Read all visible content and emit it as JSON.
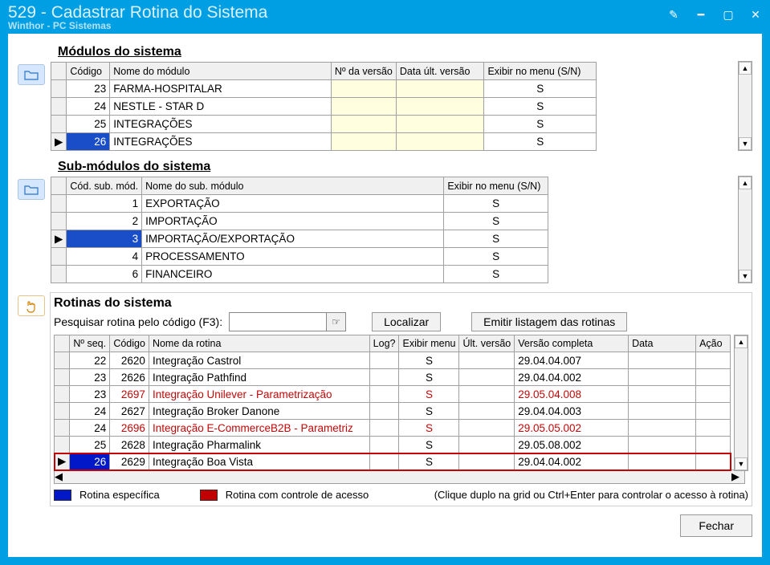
{
  "window": {
    "title": "529 - Cadastrar Rotina do Sistema",
    "subtitle": "Winthor - PC Sistemas"
  },
  "modules": {
    "title": "Módulos do sistema",
    "headers": {
      "code": "Código",
      "name": "Nome do módulo",
      "ver": "Nº da versão",
      "date": "Data últ. versão",
      "show": "Exibir no menu (S/N)"
    },
    "rows": [
      {
        "code": "23",
        "name": "FARMA-HOSPITALAR",
        "ver": "",
        "date": "",
        "show": "S",
        "selected": false
      },
      {
        "code": "24",
        "name": "NESTLE - STAR D",
        "ver": "",
        "date": "",
        "show": "S",
        "selected": false
      },
      {
        "code": "25",
        "name": "INTEGRAÇÕES",
        "ver": "",
        "date": "",
        "show": "S",
        "selected": false
      },
      {
        "code": "26",
        "name": "INTEGRAÇÕES",
        "ver": "",
        "date": "",
        "show": "S",
        "selected": true
      }
    ]
  },
  "submodules": {
    "title": "Sub-módulos do sistema",
    "headers": {
      "code": "Cód. sub. mód.",
      "name": "Nome do sub. módulo",
      "show": "Exibir no menu (S/N)"
    },
    "rows": [
      {
        "code": "1",
        "name": "EXPORTAÇÃO",
        "show": "S",
        "selected": false
      },
      {
        "code": "2",
        "name": "IMPORTAÇÃO",
        "show": "S",
        "selected": false
      },
      {
        "code": "3",
        "name": "IMPORTAÇÃO/EXPORTAÇÃO",
        "show": "S",
        "selected": true
      },
      {
        "code": "4",
        "name": "PROCESSAMENTO",
        "show": "S",
        "selected": false
      },
      {
        "code": "6",
        "name": "FINANCEIRO",
        "show": "S",
        "selected": false
      }
    ]
  },
  "routines": {
    "title": "Rotinas do sistema",
    "search_label": "Pesquisar rotina pelo código (F3):",
    "search_value": "",
    "locate_btn": "Localizar",
    "emit_btn": "Emitir listagem das rotinas",
    "headers": {
      "seq": "Nº seq.",
      "code": "Código",
      "name": "Nome da rotina",
      "log": "Log?",
      "show": "Exibir menu",
      "ultver": "Últ. versão",
      "fullver": "Versão completa",
      "data": "Data",
      "action": "Ação"
    },
    "rows": [
      {
        "seq": "22",
        "code": "2620",
        "name": "Integração Castrol",
        "log": "",
        "show": "S",
        "ultver": "",
        "fullver": "29.04.04.007",
        "cls": ""
      },
      {
        "seq": "23",
        "code": "2626",
        "name": "Integração Pathfind",
        "log": "",
        "show": "S",
        "ultver": "",
        "fullver": "29.04.04.002",
        "cls": ""
      },
      {
        "seq": "23",
        "code": "2697",
        "name": "Integração Unilever - Parametrização",
        "log": "",
        "show": "S",
        "ultver": "",
        "fullver": "29.05.04.008",
        "cls": "red"
      },
      {
        "seq": "24",
        "code": "2627",
        "name": "Integração Broker Danone",
        "log": "",
        "show": "S",
        "ultver": "",
        "fullver": "29.04.04.003",
        "cls": ""
      },
      {
        "seq": "24",
        "code": "2696",
        "name": "Integração E-CommerceB2B - Parametriz",
        "log": "",
        "show": "S",
        "ultver": "",
        "fullver": "29.05.05.002",
        "cls": "red"
      },
      {
        "seq": "25",
        "code": "2628",
        "name": "Integração Pharmalink",
        "log": "",
        "show": "S",
        "ultver": "",
        "fullver": "29.05.08.002",
        "cls": ""
      },
      {
        "seq": "26",
        "code": "2629",
        "name": "Integração Boa Vista",
        "log": "",
        "show": "S",
        "ultver": "",
        "fullver": "29.04.04.002",
        "cls": "",
        "selected": true
      }
    ]
  },
  "legend": {
    "specific": "Rotina específica",
    "access": "Rotina com controle de acesso",
    "hint": "(Clique duplo na grid ou Ctrl+Enter para controlar o acesso à rotina)"
  },
  "footer": {
    "close": "Fechar"
  }
}
